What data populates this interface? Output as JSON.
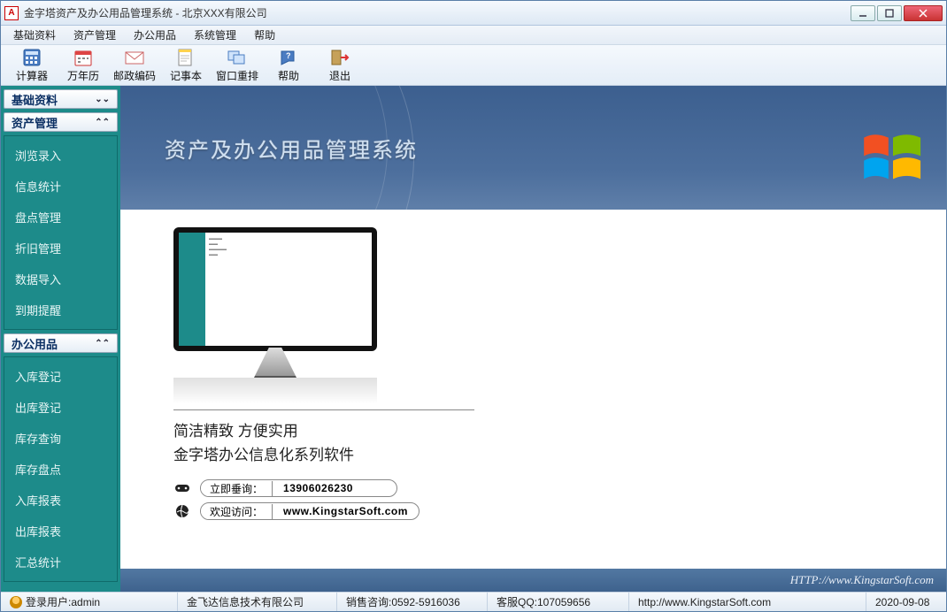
{
  "window": {
    "title": "金字塔资产及办公用品管理系统 - 北京XXX有限公司"
  },
  "menu": [
    "基础资料",
    "资产管理",
    "办公用品",
    "系统管理",
    "帮助"
  ],
  "toolbar": [
    {
      "id": "calculator",
      "label": "计算器"
    },
    {
      "id": "calendar",
      "label": "万年历"
    },
    {
      "id": "postcode",
      "label": "邮政编码"
    },
    {
      "id": "notepad",
      "label": "记事本"
    },
    {
      "id": "window-rearrange",
      "label": "窗口重排"
    },
    {
      "id": "help",
      "label": "帮助"
    },
    {
      "id": "exit",
      "label": "退出"
    }
  ],
  "sidebar": {
    "panels": [
      {
        "title": "基础资料",
        "expanded": false,
        "items": []
      },
      {
        "title": "资产管理",
        "expanded": true,
        "items": [
          "浏览录入",
          "信息统计",
          "盘点管理",
          "折旧管理",
          "数据导入",
          "到期提醒"
        ]
      },
      {
        "title": "办公用品",
        "expanded": true,
        "items": [
          "入库登记",
          "出库登记",
          "库存查询",
          "库存盘点",
          "入库报表",
          "出库报表",
          "汇总统计"
        ]
      }
    ]
  },
  "banner": {
    "title": "资产及办公用品管理系统"
  },
  "slogan": {
    "line1": "简洁精致 方便实用",
    "line2": "金字塔办公信息化系列软件"
  },
  "contacts": {
    "phone_label": "立即垂询：",
    "phone_value": "13906026230",
    "web_label": "欢迎访问：",
    "web_value": "www.KingstarSoft.com"
  },
  "footer_band": "HTTP://www.KingstarSoft.com",
  "status": {
    "user_label": "登录用户:",
    "user_value": "admin",
    "company": "金飞达信息技术有限公司",
    "sales": "销售咨询:0592-5916036",
    "cs": "客服QQ:107059656",
    "url": "http://www.KingstarSoft.com",
    "date": "2020-09-08"
  }
}
